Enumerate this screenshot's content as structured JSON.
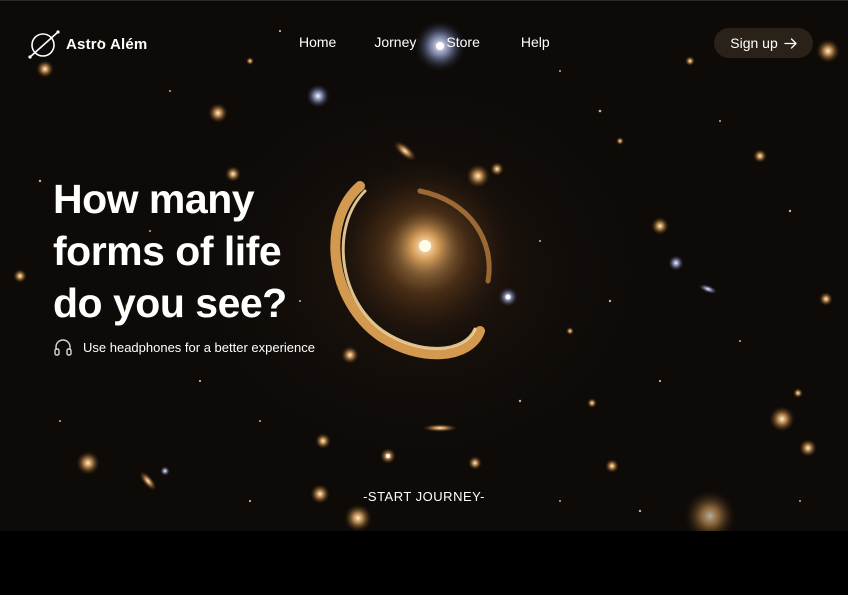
{
  "brand": {
    "name": "Astro Além",
    "logo_icon": "planet-ring-icon"
  },
  "nav": {
    "links": [
      "Home",
      "Jorney",
      "Store",
      "Help"
    ],
    "signup_label": "Sign up",
    "signup_icon": "arrow-right-icon"
  },
  "hero": {
    "title_lines": [
      "How many",
      "forms of life",
      "do you see?"
    ],
    "hint_icon": "headphones-icon",
    "hint_text": "Use headphones for a better experience",
    "cta_label": "-START JOURNEY-"
  },
  "colors": {
    "background": "#0d0a08",
    "signup_bg": "#2a2119",
    "galaxy_gold": "#e0a25a",
    "text": "#ffffff"
  }
}
